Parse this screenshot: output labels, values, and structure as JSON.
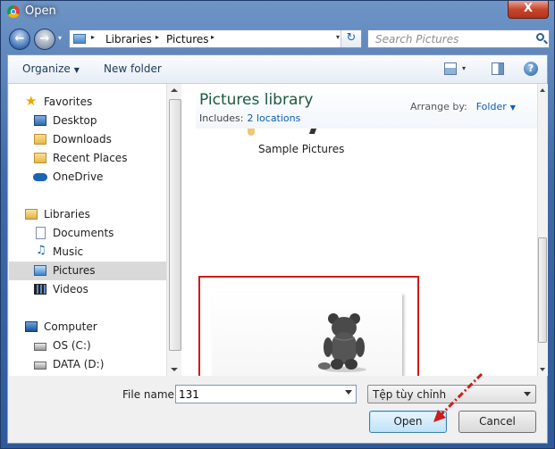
{
  "window": {
    "title": "Open",
    "close_glyph": "X"
  },
  "nav": {
    "back_glyph": "←",
    "forward_glyph": "→",
    "history_glyph": "▾",
    "breadcrumb": [
      "Libraries",
      "Pictures"
    ],
    "crumb_sep": "▸",
    "address_dropdown": "▾",
    "refresh_glyph": "↻",
    "search_placeholder": "Search Pictures"
  },
  "toolbar": {
    "organize": "Organize",
    "organize_caret": "▼",
    "new_folder": "New folder",
    "view_caret": "▾",
    "help_glyph": "?"
  },
  "sidebar": {
    "favorites": {
      "label": "Favorites",
      "icon": "star-icon"
    },
    "favorite_items": [
      {
        "label": "Desktop",
        "icon": "desktop-icon"
      },
      {
        "label": "Downloads",
        "icon": "downloads-folder-icon"
      },
      {
        "label": "Recent Places",
        "icon": "recent-places-icon"
      },
      {
        "label": "OneDrive",
        "icon": "onedrive-cloud-icon"
      }
    ],
    "libraries": {
      "label": "Libraries",
      "icon": "libraries-icon"
    },
    "library_items": [
      {
        "label": "Documents",
        "icon": "documents-icon"
      },
      {
        "label": "Music",
        "icon": "music-icon"
      },
      {
        "label": "Pictures",
        "icon": "pictures-icon",
        "selected": true
      },
      {
        "label": "Videos",
        "icon": "videos-icon"
      }
    ],
    "computer": {
      "label": "Computer",
      "icon": "computer-icon"
    },
    "computer_items": [
      {
        "label": "OS (C:)",
        "icon": "os-drive-icon"
      },
      {
        "label": "DATA (D:)",
        "icon": "data-drive-icon"
      }
    ]
  },
  "content": {
    "library_title": "Pictures library",
    "includes_label": "Includes:",
    "includes_link": "2 locations",
    "arrange_label": "Arrange by:",
    "arrange_value": "Folder",
    "arrange_caret": "▼",
    "folders": [
      {
        "name": "Sample Pictures"
      }
    ],
    "files": [
      {
        "name": "131",
        "thumbnail": "teddy-bear-photo"
      }
    ]
  },
  "footer": {
    "file_name_label": "File name:",
    "file_name_value": "131",
    "file_type_value": "Tệp tùy chỉnh",
    "open_button": "Open",
    "cancel_button": "Cancel"
  },
  "colors": {
    "annotation": "#d11a1a",
    "selection": "#d9d9d9",
    "link": "#0b5eb5",
    "title_green": "#1e5a3e"
  }
}
